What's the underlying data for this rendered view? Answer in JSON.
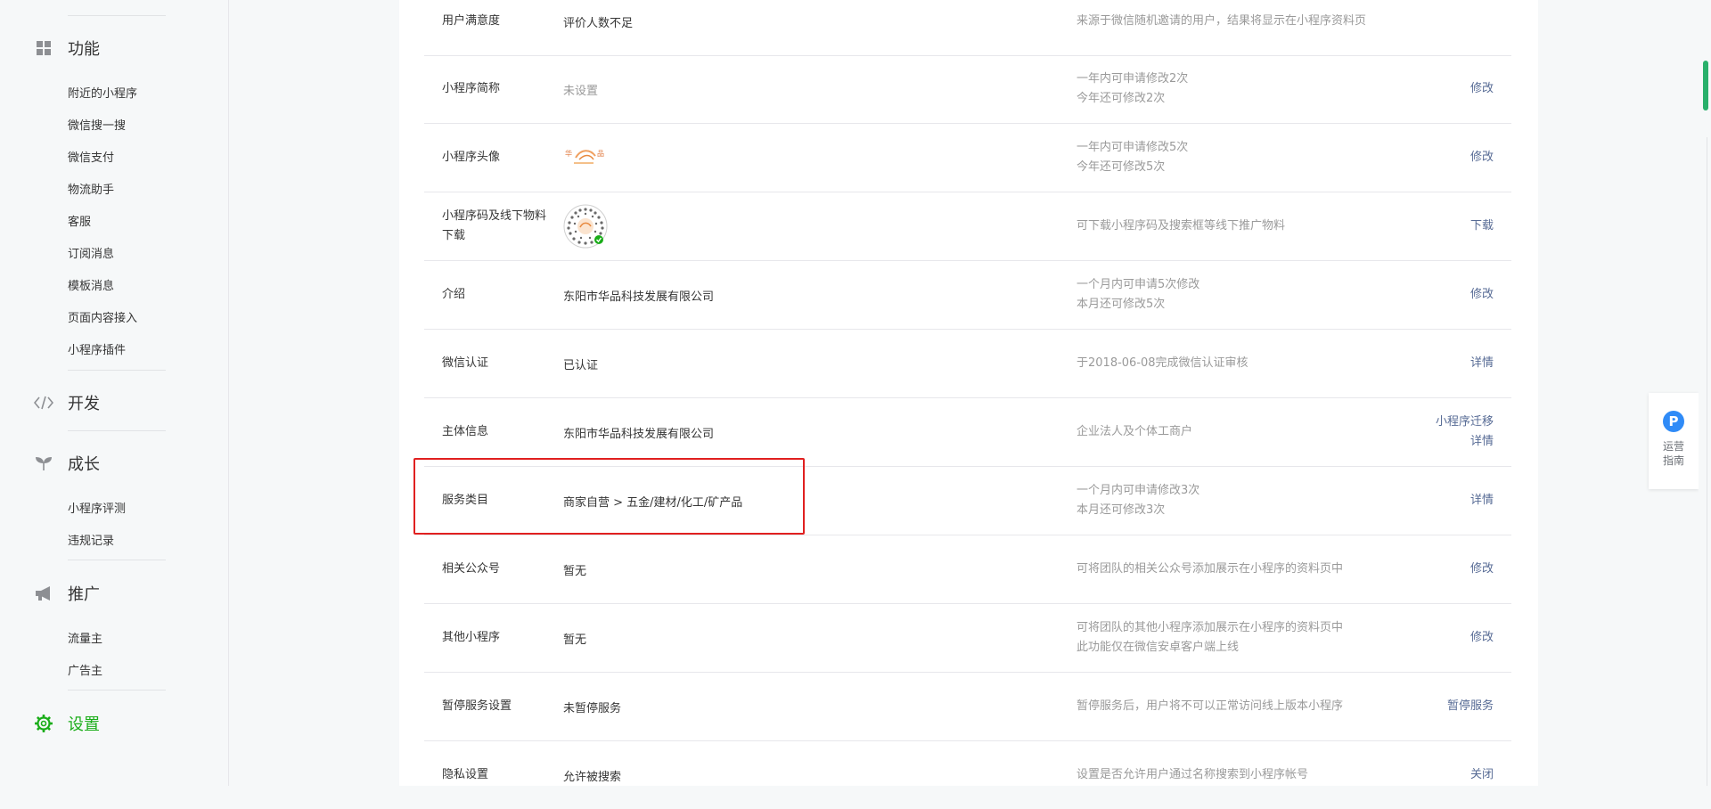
{
  "sidebar": {
    "sections": [
      {
        "label": "功能",
        "icon": "grid-icon"
      },
      {
        "label": "开发",
        "icon": "code-icon"
      },
      {
        "label": "成长",
        "icon": "sprout-icon"
      },
      {
        "label": "推广",
        "icon": "megaphone-icon"
      },
      {
        "label": "设置",
        "icon": "gear-icon"
      }
    ],
    "func_items": [
      "附近的小程序",
      "微信搜一搜",
      "微信支付",
      "物流助手",
      "客服",
      "订阅消息",
      "模板消息",
      "页面内容接入",
      "小程序插件"
    ],
    "growth_items": [
      "小程序评测",
      "违规记录"
    ],
    "promo_items": [
      "流量主",
      "广告主"
    ]
  },
  "settings": {
    "rows": [
      {
        "label": "用户满意度",
        "value": "评价人数不足",
        "desc": [
          "来源于微信随机邀请的用户，结果将显示在小程序资料页"
        ],
        "actions": []
      },
      {
        "label": "小程序简称",
        "value": "未设置",
        "muted": true,
        "desc": [
          "一年内可申请修改2次",
          "今年还可修改2次"
        ],
        "actions": [
          "修改"
        ]
      },
      {
        "label": "小程序头像",
        "value": "",
        "desc": [
          "一年内可申请修改5次",
          "今年还可修改5次"
        ],
        "actions": [
          "修改"
        ]
      },
      {
        "label": "小程序码及线下物料下载",
        "value": "",
        "desc": [
          "可下载小程序码及搜索框等线下推广物料"
        ],
        "actions": [
          "下载"
        ]
      },
      {
        "label": "介绍",
        "value": "东阳市华品科技发展有限公司",
        "desc": [
          "一个月内可申请5次修改",
          "本月还可修改5次"
        ],
        "actions": [
          "修改"
        ]
      },
      {
        "label": "微信认证",
        "value": "已认证",
        "desc": [
          "于2018-06-08完成微信认证审核"
        ],
        "actions": [
          "详情"
        ]
      },
      {
        "label": "主体信息",
        "value": "东阳市华品科技发展有限公司",
        "desc": [
          "企业法人及个体工商户"
        ],
        "actions": [
          "小程序迁移",
          "详情"
        ]
      },
      {
        "label": "服务类目",
        "value": "商家自营 > 五金/建材/化工/矿产品",
        "desc": [
          "一个月内可申请修改3次",
          "本月还可修改3次"
        ],
        "actions": [
          "详情"
        ]
      },
      {
        "label": "相关公众号",
        "value": "暂无",
        "desc": [
          "可将团队的相关公众号添加展示在小程序的资料页中"
        ],
        "actions": [
          "修改"
        ]
      },
      {
        "label": "其他小程序",
        "value": "暂无",
        "desc": [
          "可将团队的其他小程序添加展示在小程序的资料页中",
          "此功能仅在微信安卓客户端上线"
        ],
        "actions": [
          "修改"
        ]
      },
      {
        "label": "暂停服务设置",
        "value": "未暂停服务",
        "desc": [
          "暂停服务后，用户将不可以正常访问线上版本小程序"
        ],
        "actions": [
          "暂停服务"
        ]
      },
      {
        "label": "隐私设置",
        "value": "允许被搜索",
        "desc": [
          "设置是否允许用户通过名称搜索到小程序帐号"
        ],
        "actions": [
          "关闭"
        ]
      }
    ]
  },
  "guide": {
    "badge": "P",
    "label": "运营指南"
  },
  "colors": {
    "accent": "#1aad19",
    "link": "#576b95",
    "highlight_border": "#e02020",
    "scroll_thumb": "#29b06b"
  }
}
